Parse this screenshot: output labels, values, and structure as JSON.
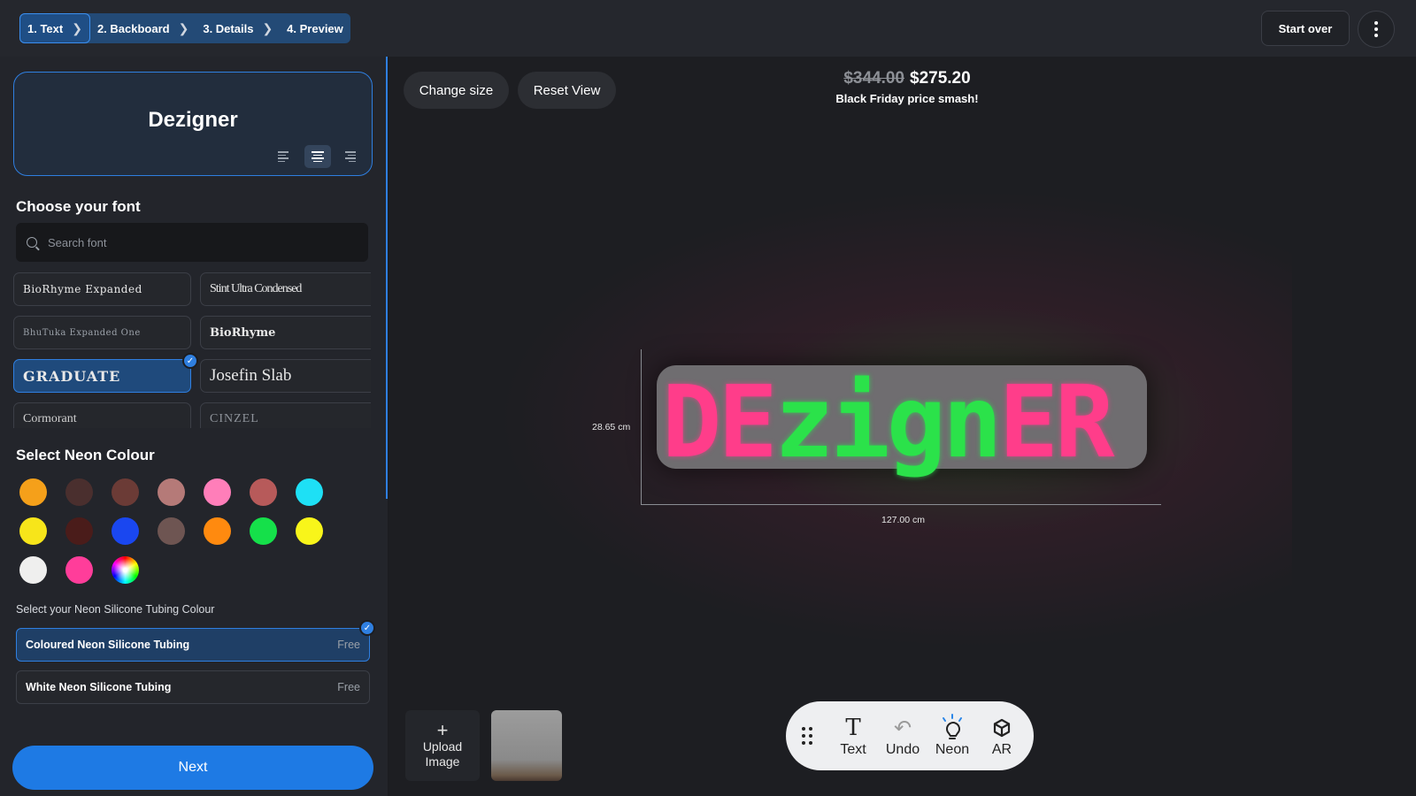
{
  "steps": [
    {
      "label": "1. Text"
    },
    {
      "label": "2. Backboard"
    },
    {
      "label": "3. Details"
    },
    {
      "label": "4. Preview"
    }
  ],
  "header": {
    "start_over": "Start over"
  },
  "text_input": {
    "value": "Dezigner"
  },
  "font_section": {
    "title": "Choose your font",
    "search_placeholder": "Search font",
    "fonts": [
      {
        "label": "BioRhyme Expanded"
      },
      {
        "label": "Stint Ultra Condensed"
      },
      {
        "label": "BhuTuka Expanded One"
      },
      {
        "label": "BioRhyme"
      },
      {
        "label": "GRADUATE",
        "selected": true
      },
      {
        "label": "Josefin Slab"
      },
      {
        "label": "Cormorant"
      },
      {
        "label": "Cinzel"
      }
    ]
  },
  "colour_section": {
    "title": "Select Neon Colour",
    "swatches": [
      "#f5a01a",
      "#4a2f2e",
      "#6b3b36",
      "#b57a78",
      "#ff7eb9",
      "#b75a5a",
      "#1ee0f5",
      "#f7e51a",
      "#4a1c1a",
      "#1a47f0",
      "#6e5552",
      "#ff8a0f",
      "#15e04a",
      "#f8f51a",
      "#efefee",
      "#ff3d9a",
      "rainbow"
    ]
  },
  "tubing_section": {
    "title": "Select your Neon Silicone Tubing Colour",
    "options": [
      {
        "label": "Coloured Neon Silicone Tubing",
        "price": "Free",
        "selected": true
      },
      {
        "label": "White Neon Silicone Tubing",
        "price": "Free",
        "selected": false
      }
    ]
  },
  "next_label": "Next",
  "canvas": {
    "change_size": "Change size",
    "reset_view": "Reset View",
    "old_price": "$344.00",
    "new_price": "$275.20",
    "price_note": "Black Friday price smash!",
    "height_label": "28.65 cm",
    "width_label": "127.00 cm",
    "neon_text": [
      {
        "text": "DE",
        "color": "pink"
      },
      {
        "text": "zign",
        "color": "green"
      },
      {
        "text": "ER",
        "color": "pink"
      }
    ],
    "upload_label_1": "Upload",
    "upload_label_2": "Image"
  },
  "toolbar": {
    "text": "Text",
    "undo": "Undo",
    "neon": "Neon",
    "ar": "AR"
  }
}
